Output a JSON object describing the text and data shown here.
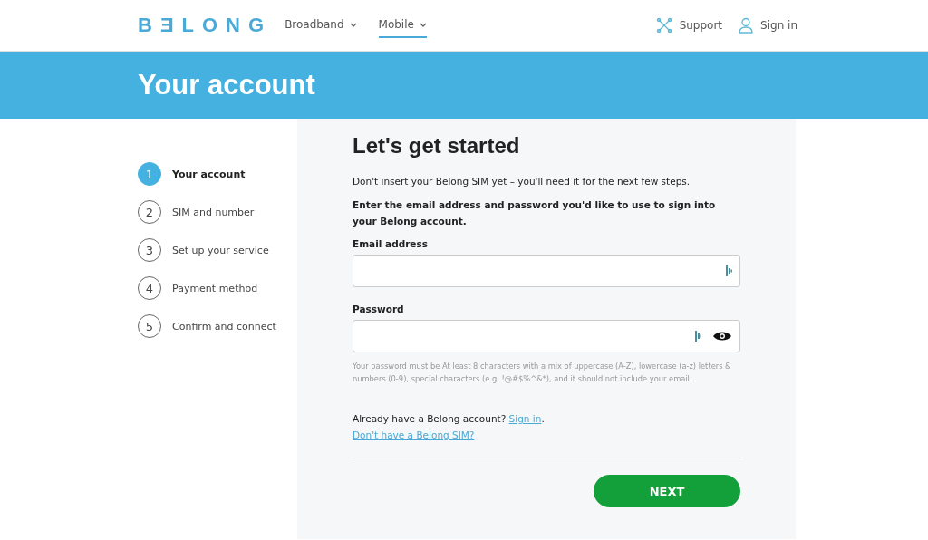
{
  "header": {
    "logo": "BƎLONG",
    "nav": [
      {
        "label": "Broadband",
        "selected": false
      },
      {
        "label": "Mobile",
        "selected": true
      }
    ],
    "actions": [
      {
        "kind": "support",
        "label": "Support"
      },
      {
        "kind": "signin",
        "label": "Sign in"
      }
    ]
  },
  "banner": {
    "title": "Your account"
  },
  "steps": [
    {
      "number": "1",
      "label": "Your account",
      "selected": true
    },
    {
      "number": "2",
      "label": "SIM and number",
      "selected": false
    },
    {
      "number": "3",
      "label": "Set up your service",
      "selected": false
    },
    {
      "number": "4",
      "label": "Payment method",
      "selected": false
    },
    {
      "number": "5",
      "label": "Confirm and connect",
      "selected": false
    }
  ],
  "form": {
    "title": "Let's get started",
    "note": "Don't insert your Belong SIM yet – you'll need it for the next few steps.",
    "instruction": "Enter the email address and password you'd like to use to sign into your Belong account.",
    "fields": [
      {
        "kind": "email",
        "label": "Email address"
      },
      {
        "kind": "password",
        "label": "Password"
      }
    ],
    "hint": "Your password must be At least 8 characters with a mix of uppercase (A-Z), lowercase (a-z) letters & numbers (0-9), special characters (e.g. !@#$%^&*), and it should not include your email.",
    "signin_prompt": "Already have a Belong account?",
    "signin_link": "Sign in",
    "signin_end": ".",
    "sim_link": "Don't have a Belong SIM?",
    "button": "NEXT"
  }
}
